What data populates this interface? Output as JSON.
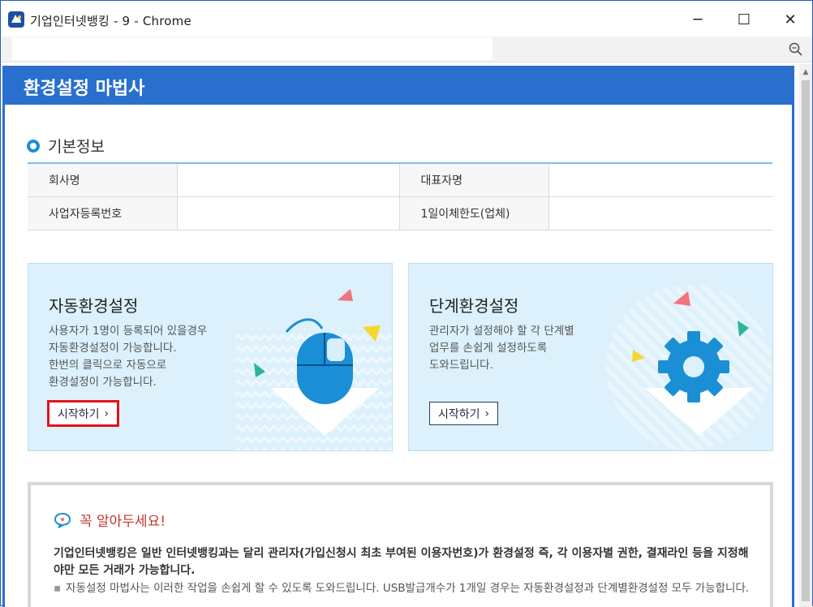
{
  "window": {
    "title": "기업인터넷뱅킹 - 9 - Chrome",
    "app_icon": "ibk-bank-icon",
    "controls": {
      "minimize": "─",
      "maximize": "☐",
      "close": "✕"
    }
  },
  "address_bar": {
    "url": "",
    "zoom_icon": "zoom-icon"
  },
  "wizard": {
    "title": "환경설정 마법사",
    "section_title": "기본정보",
    "info_table": {
      "company_label": "회사명",
      "company_value": "",
      "ceo_label": "대표자명",
      "ceo_value": "",
      "bizno_label": "사업자등록번호",
      "bizno_value": "",
      "daily_limit_label": "1일이체한도(업체)",
      "daily_limit_value": ""
    },
    "cards": {
      "auto": {
        "title": "자동환경설정",
        "desc": [
          "사용자가 1명이 등록되어 있을경우",
          "자동환경설정이 가능합니다.",
          "한번의 클릭으로 자동으로",
          "환경설정이 가능합니다."
        ],
        "button": "시작하기",
        "chevron": "›"
      },
      "step": {
        "title": "단계환경설정",
        "desc": [
          "관리자가 설정해야 할 각 단계별",
          "업무를 손쉽게 설정하도록",
          "도와드립니다."
        ],
        "button": "시작하기",
        "chevron": "›"
      }
    },
    "notice": {
      "title": "꼭 알아두세요!",
      "bold_text": "기업인터넷뱅킹은 일반 인터넷뱅킹과는 달리 관리자(가입신청시 최초 부여된 이용자번호)가 환경설정 즉, 각 이용자별 권한, 결재라인 등을 지정해야만 모든 거래가 가능합니다.",
      "bullet": "▪",
      "sub_text": "자동설정 마법사는 이러한 작업을 손쉽게 할 수 있도록 도와드립니다. USB발급개수가 1개일 경우는 자동환경설정과 단계별환경설정 모두 가능합니다."
    },
    "colors": {
      "header_blue": "#2a6fce",
      "card_bg": "#dcf1fb",
      "highlight_red": "#e0141e",
      "notice_title": "#c0392b",
      "icon_blue": "#1a8fd6"
    }
  }
}
